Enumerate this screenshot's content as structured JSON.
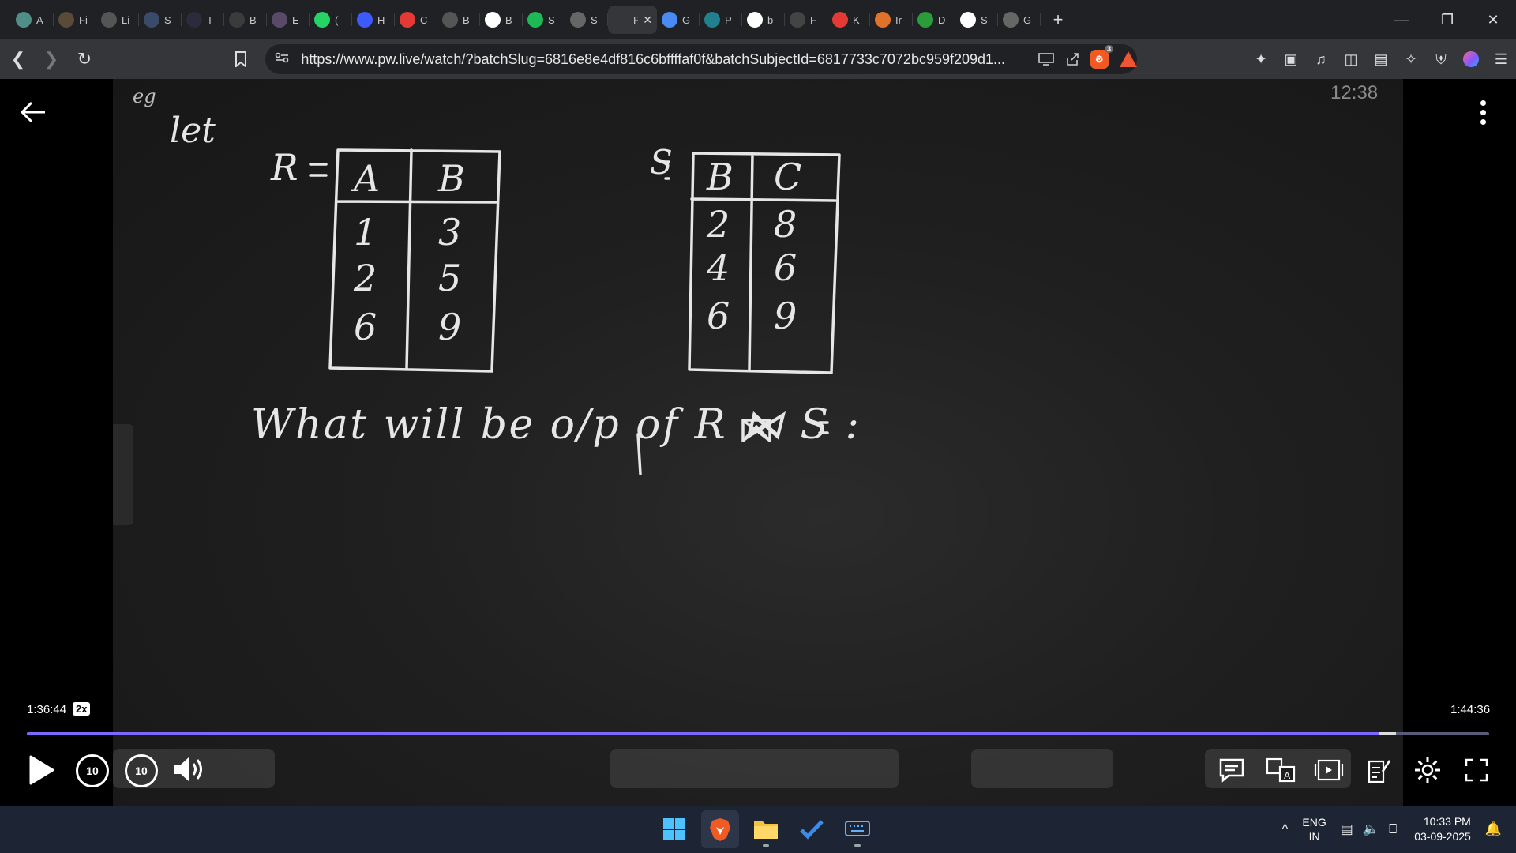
{
  "browser": {
    "tabs": [
      {
        "label": "A",
        "icon": "chat-icon",
        "color": "#4f8f88"
      },
      {
        "label": "Fi",
        "icon": "sparkle-icon",
        "color": "#5a4a3a"
      },
      {
        "label": "Li",
        "icon": "globe-icon",
        "color": "#555"
      },
      {
        "label": "S",
        "icon": "app-icon",
        "color": "#3a4a6a"
      },
      {
        "label": "T",
        "icon": "w3-icon",
        "color": "#2b2b3b"
      },
      {
        "label": "B",
        "icon": "book-icon",
        "color": "#3b3b3b"
      },
      {
        "label": "E",
        "icon": "brain-icon",
        "color": "#5a4a6a"
      },
      {
        "label": "(",
        "icon": "whatsapp-icon",
        "color": "#25d366"
      },
      {
        "label": "H",
        "icon": "bookmark-icon",
        "color": "#3d5afe"
      },
      {
        "label": "C",
        "icon": "youtube-icon",
        "color": "#e53935"
      },
      {
        "label": "B",
        "icon": "gate-icon",
        "color": "#555"
      },
      {
        "label": "B",
        "icon": "google-icon",
        "color": "#fff"
      },
      {
        "label": "S",
        "icon": "spotify-icon",
        "color": "#1db954"
      },
      {
        "label": "S",
        "icon": "globe-icon",
        "color": "#666"
      },
      {
        "label": "P",
        "icon": "pw-icon",
        "color": "#35363a",
        "active": true
      },
      {
        "label": "G",
        "icon": "gemini-icon",
        "color": "#4a8af4"
      },
      {
        "label": "P",
        "icon": "perplexity-icon",
        "color": "#20808d"
      },
      {
        "label": "b",
        "icon": "google-icon",
        "color": "#fff"
      },
      {
        "label": "F",
        "icon": "window-icon",
        "color": "#444"
      },
      {
        "label": "K",
        "icon": "youtube-icon",
        "color": "#e53935"
      },
      {
        "label": "Ir",
        "icon": "burger-icon",
        "color": "#e0722a"
      },
      {
        "label": "D",
        "icon": "crown-icon",
        "color": "#2a9d3a"
      },
      {
        "label": "S",
        "icon": "wikipedia-icon",
        "color": "#fff"
      },
      {
        "label": "G",
        "icon": "globe-icon",
        "color": "#666"
      }
    ],
    "url": "https://www.pw.live/watch/?batchSlug=6816e8e4df816c6bffffaf0f&batchSubjectId=6817733c7072bc959f209d1...",
    "shield_count": "3"
  },
  "video": {
    "stamp": "12:38",
    "board_question": "What will be o/p of  R ⋈ S :",
    "relation_R": {
      "name": "R",
      "columns": [
        "A",
        "B"
      ],
      "rows": [
        [
          "1",
          "3"
        ],
        [
          "2",
          "5"
        ],
        [
          "6",
          "9"
        ]
      ]
    },
    "relation_S": {
      "name": "S",
      "columns": [
        "B",
        "C"
      ],
      "rows": [
        [
          "2",
          "8"
        ],
        [
          "4",
          "6"
        ],
        [
          "6",
          "9"
        ]
      ]
    },
    "eg_label": "eg",
    "let_label": "let"
  },
  "player": {
    "current_time": "1:36:44",
    "speed": "2x",
    "total_time": "1:44:36",
    "progress": 0.925,
    "skip_back": "10",
    "skip_forward": "10"
  },
  "taskbar": {
    "lang_top": "ENG",
    "lang_bottom": "IN",
    "time": "10:33 PM",
    "date": "03-09-2025"
  }
}
